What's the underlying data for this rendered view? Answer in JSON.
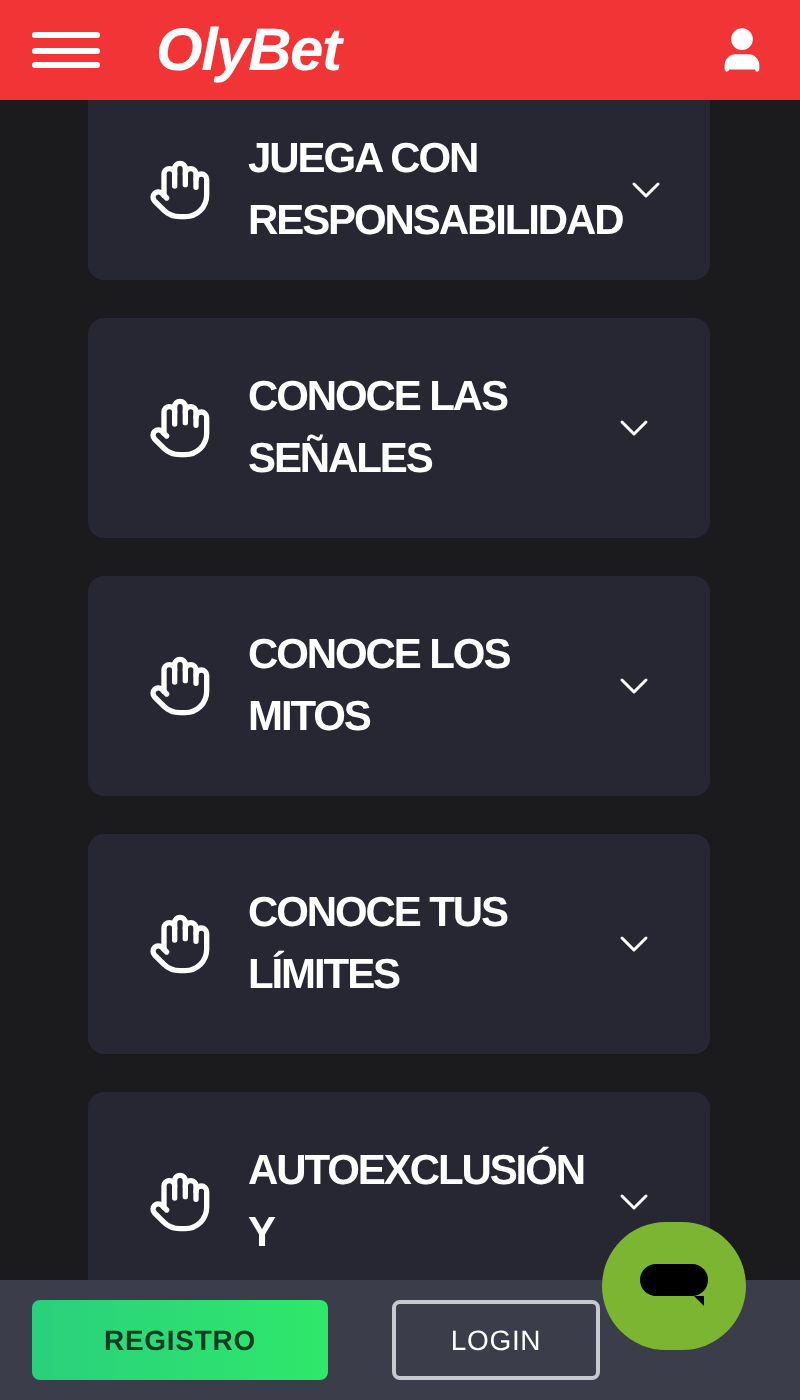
{
  "header": {
    "logo": "OlyBet"
  },
  "sections": [
    {
      "title_lines": [
        "JUEGA CON",
        "RESPONSABILIDAD"
      ],
      "expanded": false
    },
    {
      "title_lines": [
        "CONOCE LAS",
        "SEÑALES"
      ],
      "expanded": false
    },
    {
      "title_lines": [
        "CONOCE LOS",
        "MITOS"
      ],
      "expanded": false
    },
    {
      "title_lines": [
        "CONOCE TUS",
        "LÍMITES"
      ],
      "expanded": false
    },
    {
      "title_lines": [
        "AUTOEXCLUSIÓN",
        "Y"
      ],
      "expanded": false
    }
  ],
  "bottom_bar": {
    "register": "REGISTRO",
    "login": "LOGIN"
  }
}
